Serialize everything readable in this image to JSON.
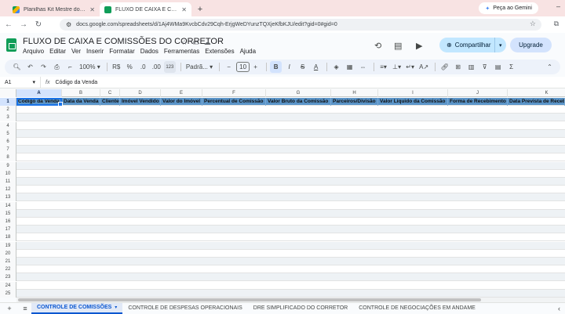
{
  "browser": {
    "tabs": [
      {
        "title": "Planilhas Kit Mestre do Corretor",
        "active": false
      },
      {
        "title": "FLUXO DE CAIXA E COMISSÕES",
        "active": true
      }
    ],
    "gemini_label": "Peça ao Gemini",
    "url": "docs.google.com/spreadsheets/d/1Aj4WMa9KvcbCdv29Cqh-ErjgWeDYunzTQXjeKfbKJU/edit?gid=0#gid=0"
  },
  "doc": {
    "title": "FLUXO DE CAIXA E COMISSÕES DO CORRETOR",
    "menu": [
      "Arquivo",
      "Editar",
      "Ver",
      "Inserir",
      "Formatar",
      "Dados",
      "Ferramentas",
      "Extensões",
      "Ajuda"
    ],
    "share_label": "Compartilhar",
    "upgrade_label": "Upgrade"
  },
  "toolbar": {
    "zoom": "100%",
    "currency": "R$",
    "percent": "%",
    "decimals_dec": ".0",
    "decimals_inc": ".00",
    "format_more": "123",
    "font": "Padrã...",
    "font_size": "10",
    "bold": "B"
  },
  "formula_bar": {
    "cell_ref": "A1",
    "fx": "fx",
    "content": "Código da Venda"
  },
  "grid": {
    "columns": [
      "A",
      "B",
      "C",
      "D",
      "E",
      "F",
      "G",
      "H",
      "I",
      "J",
      "K"
    ],
    "rows": [
      "1",
      "2",
      "3",
      "4",
      "5",
      "6",
      "7",
      "8",
      "9",
      "10",
      "11",
      "12",
      "13",
      "14",
      "15",
      "16",
      "17",
      "18",
      "19",
      "20",
      "21",
      "22",
      "23",
      "24",
      "25"
    ],
    "headers": [
      "Código da Venda",
      "Data da Venda",
      "Cliente",
      "Imóvel Vendido",
      "Valor do Imóvel",
      "Percentual de Comissão",
      "Valor Bruto da Comissão",
      "Parceiros/Divisão",
      "Valor Líquido da Comissão",
      "Forma de Recebimento",
      "Data Prevista de Receb"
    ],
    "header_color": "#5b95c9"
  },
  "sheets": {
    "tabs": [
      "CONTROLE DE COMISSÕES",
      "CONTROLE DE DESPESAS OPERACIONAIS",
      "DRE SIMPLIFICADO DO CORRETOR",
      "CONTROLE DE NEGOCIAÇÕES EM ANDAME"
    ],
    "active_index": 0
  }
}
